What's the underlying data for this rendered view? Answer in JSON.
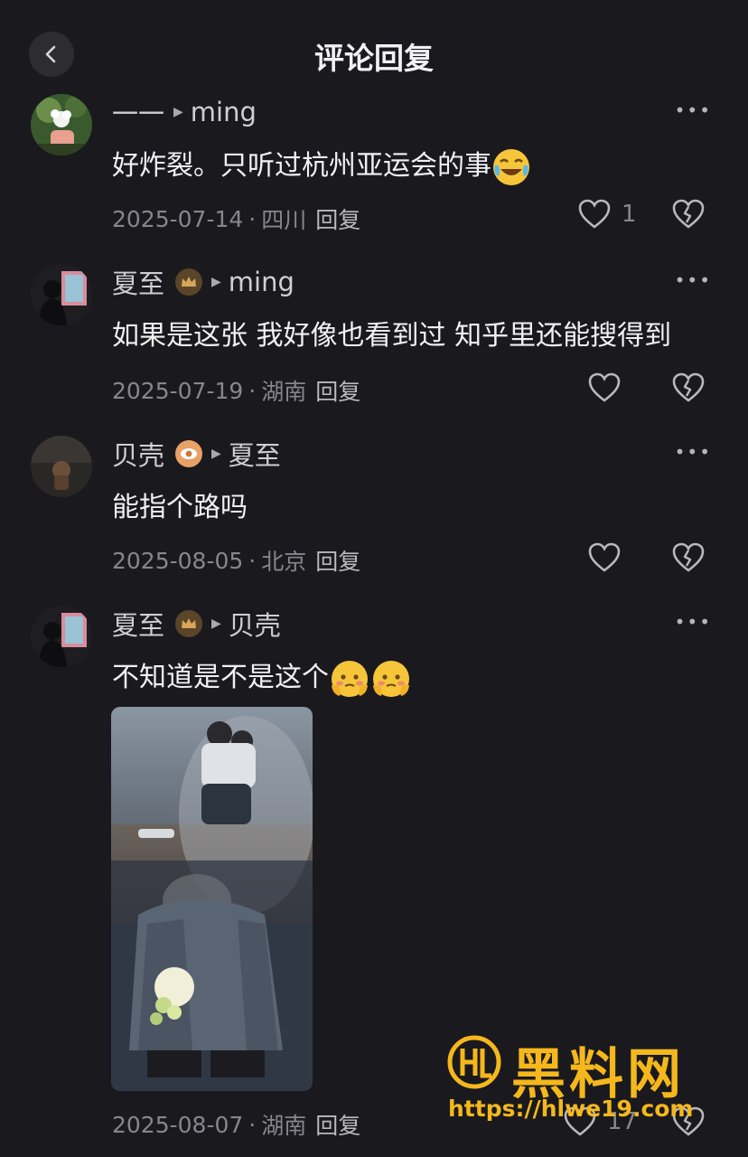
{
  "header": {
    "title": "评论回复"
  },
  "comments": [
    {
      "author": "一一",
      "reply_to": "ming",
      "text": "好炸裂。只听过杭州亚运会的事",
      "emoji": "laugh-cry-emoji",
      "date": "2025-07-14",
      "location": "四川",
      "reply_label": "回复",
      "likes": "1"
    },
    {
      "author": "夏至",
      "badge": "crown-badge",
      "reply_to": "ming",
      "text": "如果是这张  我好像也看到过  知乎里还能搜得到",
      "date": "2025-07-19",
      "location": "湖南",
      "reply_label": "回复"
    },
    {
      "author": "贝壳",
      "badge": "eye-badge",
      "reply_to": "夏至",
      "text": "能指个路吗",
      "date": "2025-08-05",
      "location": "北京",
      "reply_label": "回复"
    },
    {
      "author": "夏至",
      "badge": "crown-badge",
      "reply_to": "贝壳",
      "text": "不知道是不是这个",
      "emoji": "shy-emoji",
      "date": "2025-08-07",
      "location": "湖南",
      "reply_label": "回复",
      "likes": "17"
    }
  ],
  "watermark": {
    "brand": "黑料网",
    "url": "https://hlwe19.com"
  },
  "colors": {
    "background": "#1a1a1e",
    "text": "#f1f1f3",
    "meta": "#86868c",
    "watermark": "#f5b81c"
  }
}
